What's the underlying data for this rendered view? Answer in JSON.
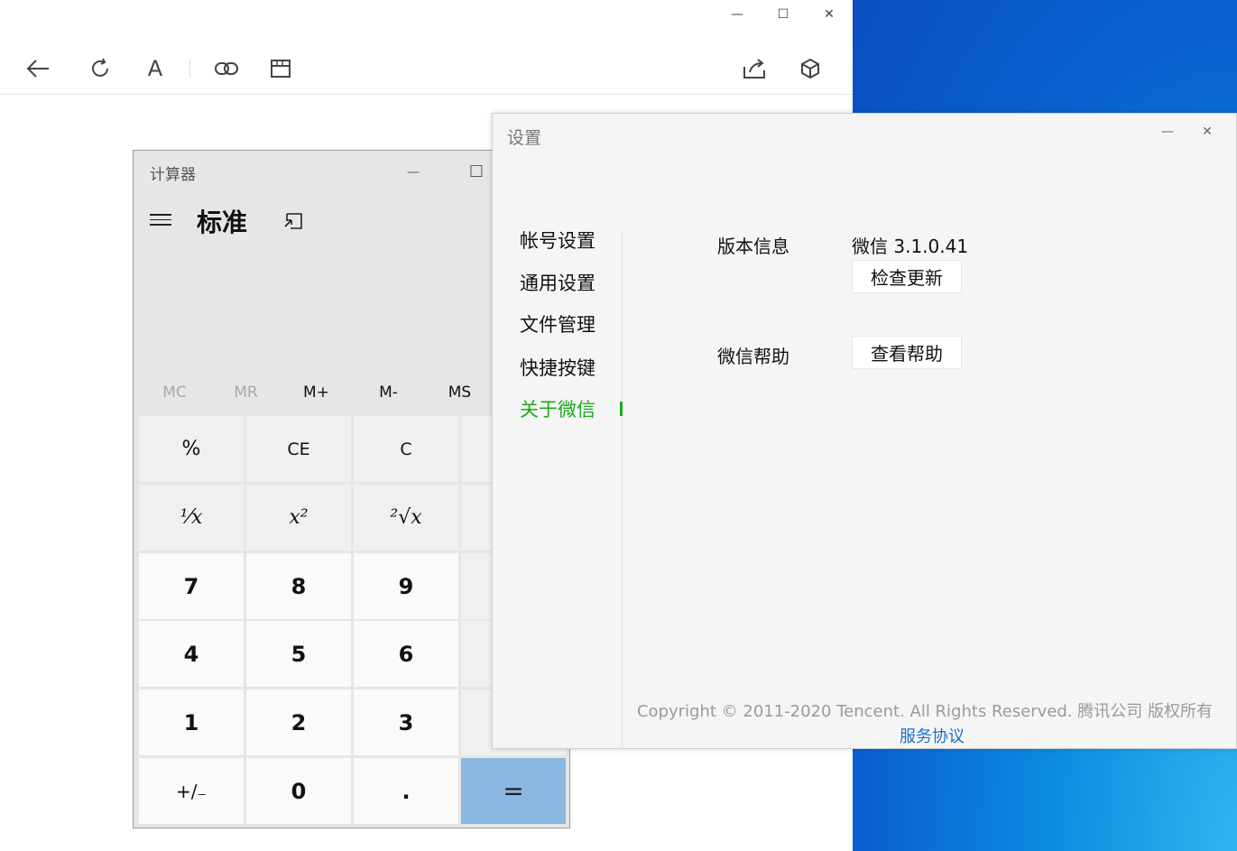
{
  "browser": {
    "window_controls": {
      "minimize": "—",
      "maximize": "☐",
      "close": "✕"
    },
    "toolbar": {
      "back": "back-arrow-icon",
      "refresh": "refresh-icon",
      "font": "A",
      "link": "link-icon",
      "reader": "reader-view-icon",
      "share": "share-icon",
      "cube": "3d-cube-icon"
    }
  },
  "calculator": {
    "title": "计算器",
    "mode": "标准",
    "window_controls": {
      "minimize": "—",
      "maximize": "☐"
    },
    "memory": [
      "MC",
      "MR",
      "M+",
      "M-",
      "MS"
    ],
    "keys": [
      [
        "%",
        "CE",
        "C"
      ],
      [
        "¹⁄x",
        "x²",
        "²√x"
      ],
      [
        "7",
        "8",
        "9"
      ],
      [
        "4",
        "5",
        "6"
      ],
      [
        "1",
        "2",
        "3"
      ],
      [
        "+/₋",
        "0",
        ".",
        "="
      ]
    ]
  },
  "settings": {
    "title": "设置",
    "window_controls": {
      "minimize": "—",
      "close": "✕"
    },
    "nav": [
      "帐号设置",
      "通用设置",
      "文件管理",
      "快捷按键",
      "关于微信"
    ],
    "active_nav": "关于微信",
    "version_label": "版本信息",
    "version_value": "微信 3.1.0.41",
    "check_update": "检查更新",
    "help_label": "微信帮助",
    "view_help": "查看帮助",
    "copyright": "Copyright © 2011-2020 Tencent. All Rights Reserved. 腾讯公司 版权所有",
    "agreement": "服务协议",
    "accent": "#1aad19",
    "link_color": "#1f6bd1"
  }
}
